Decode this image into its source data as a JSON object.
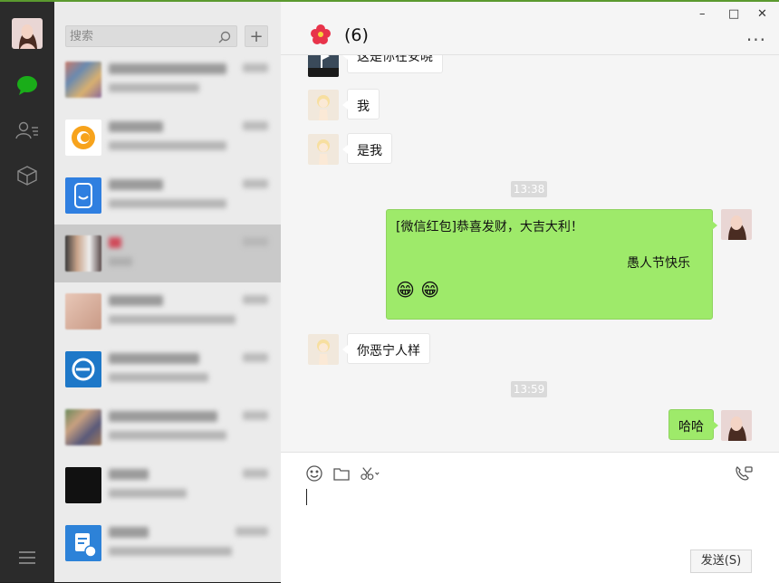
{
  "app": {
    "accent": "#9eea6a",
    "rail_bg": "#2b2b2b"
  },
  "rail": {
    "items": [
      {
        "name": "avatar"
      },
      {
        "name": "chat-icon",
        "active": true
      },
      {
        "name": "contacts-icon"
      },
      {
        "name": "box-icon"
      },
      {
        "name": "menu-icon"
      }
    ]
  },
  "search": {
    "placeholder": "搜索",
    "value": ""
  },
  "add_button": {
    "label": "+"
  },
  "chat": {
    "title": "(6)",
    "more_label": "···",
    "window": {
      "minimize": "–",
      "maximize": "□",
      "close": "✕"
    },
    "messages": [
      {
        "dir": "in",
        "text": "这是你在安晓"
      },
      {
        "dir": "in",
        "text": "我"
      },
      {
        "dir": "in",
        "text": "是我"
      },
      {
        "type": "time",
        "text": "13:38"
      },
      {
        "dir": "out",
        "line1": "[微信红包]恭喜发财，大吉大利！",
        "line2": "愚人节快乐",
        "emojis": "😁 😁"
      },
      {
        "dir": "in",
        "text": "你恶宁人样"
      },
      {
        "type": "time",
        "text": "13:59"
      },
      {
        "dir": "out",
        "text": "哈哈"
      }
    ]
  },
  "composer": {
    "send_label": "发送(S)",
    "tools": [
      "emoji-icon",
      "folder-icon",
      "scissors-icon",
      "video-call-icon"
    ]
  }
}
